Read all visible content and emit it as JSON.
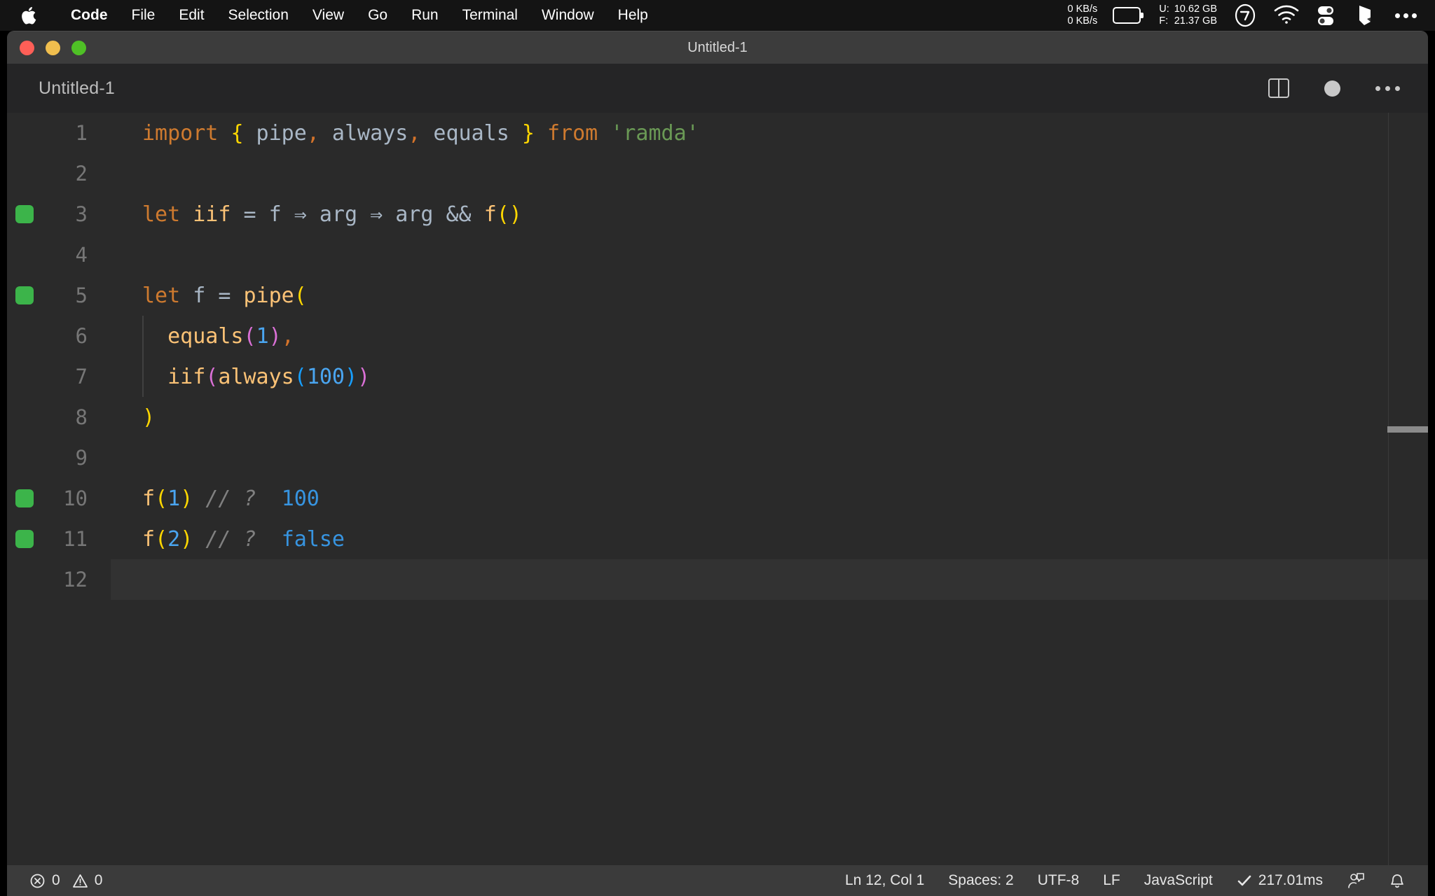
{
  "menubar": {
    "apple_icon": "apple-logo-icon",
    "items": [
      {
        "label": "Code",
        "bold": true
      },
      {
        "label": "File",
        "bold": false
      },
      {
        "label": "Edit",
        "bold": false
      },
      {
        "label": "Selection",
        "bold": false
      },
      {
        "label": "View",
        "bold": false
      },
      {
        "label": "Go",
        "bold": false
      },
      {
        "label": "Run",
        "bold": false
      },
      {
        "label": "Terminal",
        "bold": false
      },
      {
        "label": "Window",
        "bold": false
      },
      {
        "label": "Help",
        "bold": false
      }
    ],
    "status": {
      "net_up": "0 KB/s",
      "net_down": "0 KB/s",
      "battery_icon": "battery-icon",
      "mem_label_used": "U:",
      "mem_label_free": "F:",
      "mem_used": "10.62 GB",
      "mem_free": "21.37 GB",
      "stats_icon": "stats-circle-icon",
      "wifi_icon": "wifi-icon",
      "toggles_icon": "control-center-icon",
      "siri_icon": "siri-icon",
      "more_icon": "more-dots-icon"
    }
  },
  "window": {
    "title": "Untitled-1",
    "traffic": {
      "close_color": "#ff5f57",
      "minimize_color": "#f0be4e",
      "maximize_color": "#4fc026"
    }
  },
  "editor": {
    "tab_label": "Untitled-1",
    "actions": {
      "split_label": "split-editor",
      "dirty_label": "unsaved-indicator",
      "more_label": "more-actions"
    },
    "gutter_marker_color": "#3cb44a",
    "lines": [
      {
        "number": "1",
        "marker": false,
        "current": false,
        "indent_guide": false,
        "tokens": [
          {
            "text": "import",
            "cls": "t-kw"
          },
          {
            "text": " ",
            "cls": "t-op"
          },
          {
            "text": "{",
            "cls": "t-b1"
          },
          {
            "text": " pipe",
            "cls": "t-var"
          },
          {
            "text": ",",
            "cls": "t-comma"
          },
          {
            "text": " always",
            "cls": "t-var"
          },
          {
            "text": ",",
            "cls": "t-comma"
          },
          {
            "text": " equals ",
            "cls": "t-var"
          },
          {
            "text": "}",
            "cls": "t-b1"
          },
          {
            "text": " ",
            "cls": "t-op"
          },
          {
            "text": "from",
            "cls": "t-kw"
          },
          {
            "text": " ",
            "cls": "t-op"
          },
          {
            "text": "'ramda'",
            "cls": "t-str"
          }
        ]
      },
      {
        "number": "2",
        "marker": false,
        "current": false,
        "indent_guide": false,
        "tokens": []
      },
      {
        "number": "3",
        "marker": true,
        "current": false,
        "indent_guide": false,
        "tokens": [
          {
            "text": "let",
            "cls": "t-kw"
          },
          {
            "text": " ",
            "cls": "t-op"
          },
          {
            "text": "iif",
            "cls": "t-fn"
          },
          {
            "text": " = ",
            "cls": "t-op"
          },
          {
            "text": "f",
            "cls": "t-var"
          },
          {
            "text": " ⇒ ",
            "cls": "t-op"
          },
          {
            "text": "arg",
            "cls": "t-var"
          },
          {
            "text": " ⇒ ",
            "cls": "t-op"
          },
          {
            "text": "arg",
            "cls": "t-var"
          },
          {
            "text": " && ",
            "cls": "t-op"
          },
          {
            "text": "f",
            "cls": "t-fn"
          },
          {
            "text": "()",
            "cls": "t-b1"
          }
        ]
      },
      {
        "number": "4",
        "marker": false,
        "current": false,
        "indent_guide": false,
        "tokens": []
      },
      {
        "number": "5",
        "marker": true,
        "current": false,
        "indent_guide": false,
        "tokens": [
          {
            "text": "let",
            "cls": "t-kw"
          },
          {
            "text": " ",
            "cls": "t-op"
          },
          {
            "text": "f",
            "cls": "t-var"
          },
          {
            "text": " = ",
            "cls": "t-op"
          },
          {
            "text": "pipe",
            "cls": "t-fn"
          },
          {
            "text": "(",
            "cls": "t-b1"
          }
        ]
      },
      {
        "number": "6",
        "marker": false,
        "current": false,
        "indent_guide": true,
        "tokens": [
          {
            "text": "  equals",
            "cls": "t-fn"
          },
          {
            "text": "(",
            "cls": "t-b2"
          },
          {
            "text": "1",
            "cls": "t-num"
          },
          {
            "text": ")",
            "cls": "t-b2"
          },
          {
            "text": ",",
            "cls": "t-comma"
          }
        ]
      },
      {
        "number": "7",
        "marker": false,
        "current": false,
        "indent_guide": true,
        "tokens": [
          {
            "text": "  iif",
            "cls": "t-fn"
          },
          {
            "text": "(",
            "cls": "t-b2"
          },
          {
            "text": "always",
            "cls": "t-fn"
          },
          {
            "text": "(",
            "cls": "t-b3"
          },
          {
            "text": "100",
            "cls": "t-num"
          },
          {
            "text": ")",
            "cls": "t-b3"
          },
          {
            "text": ")",
            "cls": "t-b2"
          }
        ]
      },
      {
        "number": "8",
        "marker": false,
        "current": false,
        "indent_guide": false,
        "tokens": [
          {
            "text": ")",
            "cls": "t-b1"
          }
        ]
      },
      {
        "number": "9",
        "marker": false,
        "current": false,
        "indent_guide": false,
        "tokens": []
      },
      {
        "number": "10",
        "marker": true,
        "current": false,
        "indent_guide": false,
        "tokens": [
          {
            "text": "f",
            "cls": "t-fn"
          },
          {
            "text": "(",
            "cls": "t-b1"
          },
          {
            "text": "1",
            "cls": "t-num"
          },
          {
            "text": ")",
            "cls": "t-b1"
          },
          {
            "text": " ",
            "cls": "t-op"
          },
          {
            "text": "// ?",
            "cls": "t-com"
          },
          {
            "text": "  ",
            "cls": "t-op"
          },
          {
            "text": "100",
            "cls": "t-val"
          }
        ]
      },
      {
        "number": "11",
        "marker": true,
        "current": false,
        "indent_guide": false,
        "tokens": [
          {
            "text": "f",
            "cls": "t-fn"
          },
          {
            "text": "(",
            "cls": "t-b1"
          },
          {
            "text": "2",
            "cls": "t-num"
          },
          {
            "text": ")",
            "cls": "t-b1"
          },
          {
            "text": " ",
            "cls": "t-op"
          },
          {
            "text": "// ?",
            "cls": "t-com"
          },
          {
            "text": "  ",
            "cls": "t-op"
          },
          {
            "text": "false",
            "cls": "t-val"
          }
        ]
      },
      {
        "number": "12",
        "marker": false,
        "current": true,
        "indent_guide": false,
        "tokens": []
      }
    ]
  },
  "statusbar": {
    "errors_icon": "error-circle-icon",
    "errors_count": "0",
    "warnings_icon": "warning-triangle-icon",
    "warnings_count": "0",
    "cursor_position": "Ln 12, Col 1",
    "indentation": "Spaces: 2",
    "encoding": "UTF-8",
    "eol": "LF",
    "language_mode": "JavaScript",
    "run_check_icon": "check-icon",
    "run_time": "217.01ms",
    "feedback_icon": "account-feedback-icon",
    "bell_icon": "bell-icon"
  }
}
